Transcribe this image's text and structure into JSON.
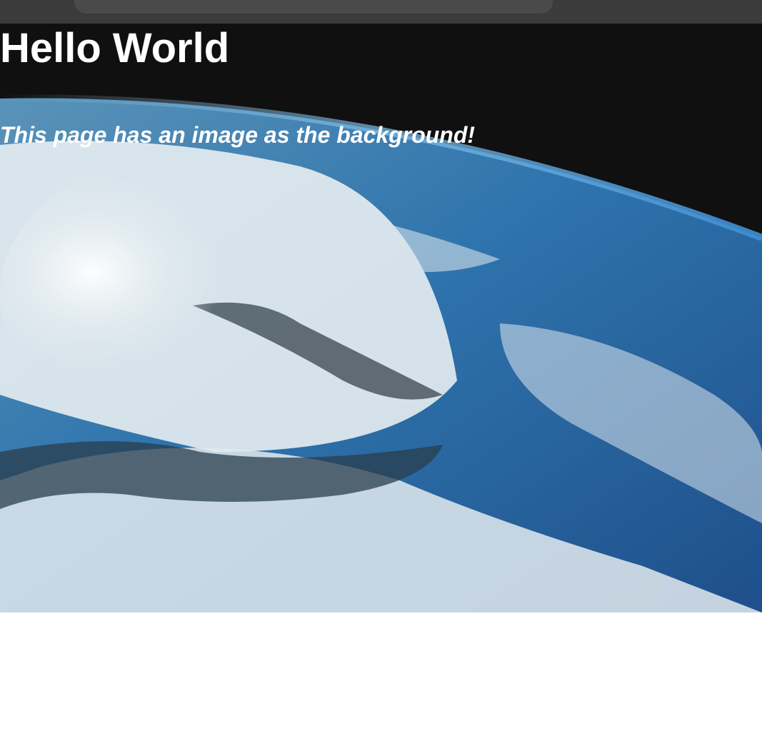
{
  "page": {
    "heading": "Hello World",
    "subheading": "This page has an image as the background!"
  },
  "background_image": {
    "subject": "earth-from-space-photo"
  },
  "colors": {
    "toolbar": "#3b3b3b",
    "address_bar": "#4a4a4a",
    "space": "#101010",
    "ocean": "#2d6fa8",
    "clouds": "#e8eef2",
    "text": "#ffffff",
    "page_background": "#ffffff"
  }
}
